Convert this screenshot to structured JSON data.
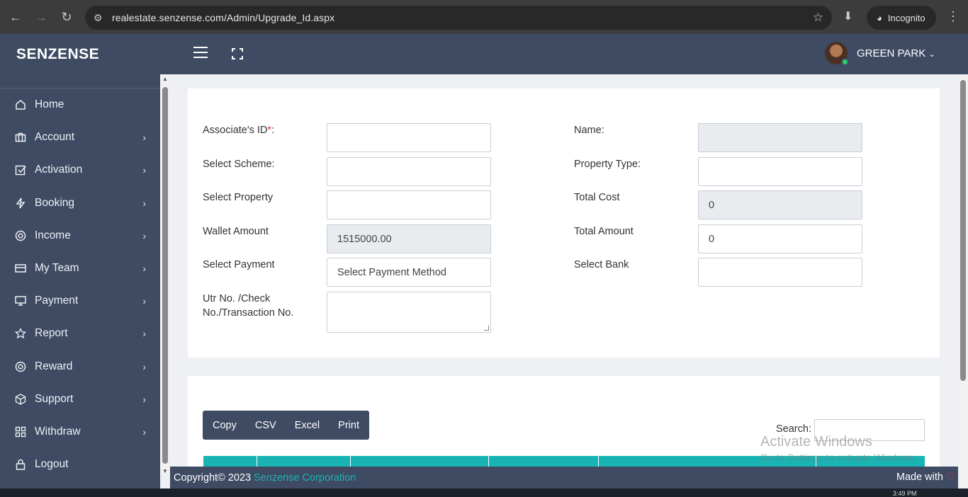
{
  "browser": {
    "url": "realestate.senzense.com/Admin/Upgrade_Id.aspx",
    "incognito_label": "Incognito"
  },
  "header": {
    "brand": "SENZENSE",
    "user_name": "GREEN PARK"
  },
  "sidebar": {
    "items": [
      {
        "label": "Home",
        "icon": "home-icon"
      },
      {
        "label": "Account",
        "icon": "briefcase-icon"
      },
      {
        "label": "Activation",
        "icon": "check-square-icon"
      },
      {
        "label": "Booking",
        "icon": "lightning-icon"
      },
      {
        "label": "Income",
        "icon": "lifebuoy-icon"
      },
      {
        "label": "My Team",
        "icon": "card-icon"
      },
      {
        "label": "Payment",
        "icon": "monitor-icon"
      },
      {
        "label": "Report",
        "icon": "star-icon"
      },
      {
        "label": "Reward",
        "icon": "lifebuoy-icon"
      },
      {
        "label": "Support",
        "icon": "box-icon"
      },
      {
        "label": "Withdraw",
        "icon": "grid-icon"
      },
      {
        "label": "Logout",
        "icon": "lock-icon"
      }
    ]
  },
  "form": {
    "associate_id_label": "Associate's ID",
    "associate_id_required": "*",
    "associate_id_colon": ":",
    "associate_id_value": "",
    "select_scheme_label": "Select Scheme:",
    "select_scheme_value": "",
    "select_property_label": "Select Property",
    "select_property_value": "",
    "wallet_amount_label": "Wallet Amount",
    "wallet_amount_value": "1515000.00",
    "select_payment_label": "Select Payment",
    "select_payment_value": "Select Payment Method",
    "utr_label_line1": "Utr No. /Check",
    "utr_label_line2": "No./Transaction No.",
    "utr_value": "",
    "name_label": "Name:",
    "name_value": "",
    "property_type_label": "Property Type:",
    "property_type_value": "",
    "total_cost_label": "Total Cost",
    "total_cost_value": "0",
    "total_amount_label": "Total Amount",
    "total_amount_value": "0",
    "select_bank_label": "Select Bank",
    "select_bank_value": ""
  },
  "table_tools": {
    "copy": "Copy",
    "csv": "CSV",
    "excel": "Excel",
    "print": "Print",
    "search_label": "Search:",
    "search_value": ""
  },
  "watermark": {
    "line1": "Activate Windows",
    "line2": "Go to Settings to activate Windows."
  },
  "footer": {
    "copyright": "Copyright© 2023",
    "company": "Senzense Corporation",
    "made_with": "Made with"
  },
  "taskbar": {
    "time": "3:49 PM"
  },
  "colors": {
    "sidebar_bg": "#3e4b63",
    "accent_teal": "#1ab3b3",
    "required_red": "#e53935"
  }
}
